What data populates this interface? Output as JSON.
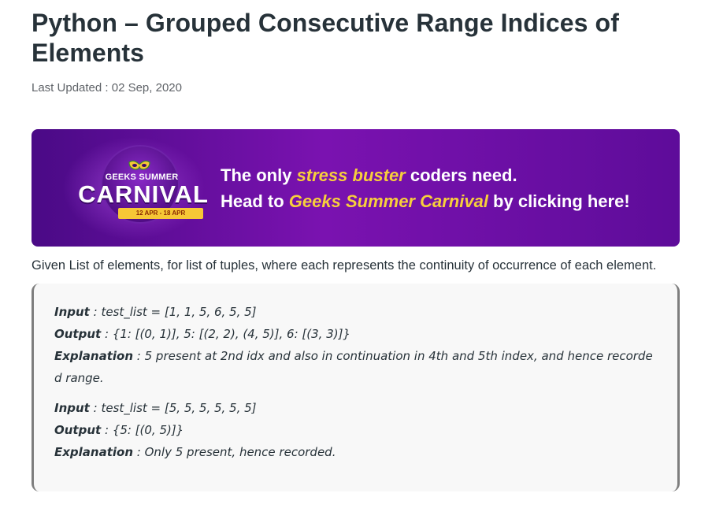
{
  "article": {
    "title": "Python – Grouped Consecutive Range Indices of Elements",
    "last_updated": "Last Updated : 02 Sep, 2020"
  },
  "banner": {
    "logo": {
      "top": "GEEKS SUMMER",
      "main": "CARNIVAL",
      "dates": "12 APR - 18 APR"
    },
    "line1": {
      "pre": "The only ",
      "highlight": "stress buster",
      "post": " coders need."
    },
    "line2": {
      "pre": "Head to ",
      "highlight": "Geeks Summer Carnival",
      "post": " by clicking here!"
    },
    "colors": {
      "background": "#6a10a3",
      "highlight": "#f7cf3c"
    }
  },
  "intro": "Given List of elements, for list of tuples, where each represents the continuity of occurrence of each element.",
  "examples": [
    {
      "input_label": "Input",
      "input_value": " : test_list = [1, 1, 5, 6, 5, 5]",
      "output_label": "Output",
      "output_value": " : {1: [(0, 1)], 5: [(2, 2), (4, 5)], 6: [(3, 3)]}",
      "explanation_label": "Explanation",
      "explanation_value": " : 5 present at 2nd idx and also in continuation in 4th and 5th index, and hence recorded range."
    },
    {
      "input_label": "Input",
      "input_value": " : test_list = [5, 5, 5, 5, 5, 5]",
      "output_label": "Output",
      "output_value": " : {5: [(0, 5)]}",
      "explanation_label": "Explanation",
      "explanation_value": " : Only 5 present, hence recorded."
    }
  ]
}
